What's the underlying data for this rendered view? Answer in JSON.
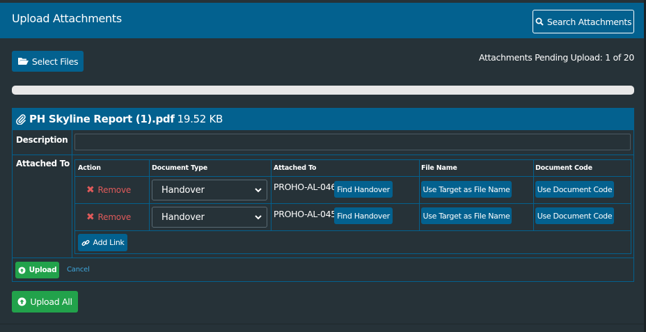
{
  "header": {
    "title": "Upload Attachments",
    "search_button": "Search Attachments"
  },
  "toolbar": {
    "select_files": "Select Files",
    "pending_text": "Attachments Pending Upload: 1 of 20"
  },
  "progress": {
    "percent": 0
  },
  "file": {
    "name": "PH Skyline Report (1).pdf",
    "size": "19.52 KB",
    "description_label": "Description",
    "description_value": "",
    "attached_to_label": "Attached To",
    "columns": [
      "Action",
      "Document Type",
      "Attached To",
      "File Name",
      "Document Code"
    ],
    "rows": [
      {
        "action": "Remove",
        "document_type": "Handover",
        "attached_to": "PROHO-AL-046",
        "find_button": "Find Handover",
        "file_name_button": "Use Target as File Name",
        "doc_code_button": "Use Document Code"
      },
      {
        "action": "Remove",
        "document_type": "Handover",
        "attached_to": "PROHO-AL-045",
        "find_button": "Find Handover",
        "file_name_button": "Use Target as File Name",
        "doc_code_button": "Use Document Code"
      }
    ],
    "add_link": "Add Link",
    "upload": "Upload",
    "cancel": "Cancel"
  },
  "footer": {
    "upload_all": "Upload All"
  },
  "colors": {
    "primary": "#03618f",
    "success": "#22a24b",
    "danger": "#e05a5a",
    "background": "#263238",
    "link": "#3ea6dc"
  }
}
